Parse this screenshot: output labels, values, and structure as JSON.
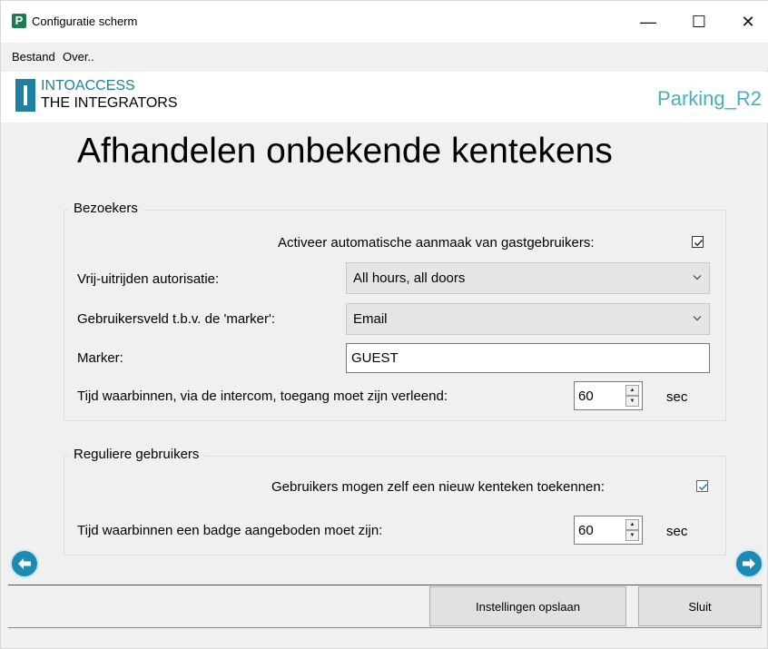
{
  "window": {
    "title": "Configuratie scherm",
    "app_icon_letter": "P",
    "controls": {
      "minimize": "—",
      "maximize": "☐",
      "close": "✕"
    }
  },
  "menu": {
    "items": [
      "Bestand",
      "Over.."
    ]
  },
  "banner": {
    "logo_line1": "INTOACCESS",
    "logo_line2": "THE INTEGRATORS",
    "site_name": "Parking_R2",
    "accent_color": "#1f7fa0"
  },
  "page_title": "Afhandelen onbekende kentekens",
  "visitors": {
    "group_label": "Bezoekers",
    "auto_guest_label": "Activeer automatische aanmaak van gastgebruikers:",
    "auto_guest_checked": true,
    "exit_auth_label": "Vrij-uitrijden autorisatie:",
    "exit_auth_value": "All hours, all doors",
    "marker_field_label": "Gebruikersveld t.b.v. de 'marker':",
    "marker_field_value": "Email",
    "marker_label": "Marker:",
    "marker_value": "GUEST",
    "intercom_time_label": "Tijd waarbinnen, via de intercom, toegang moet zijn verleend:",
    "intercom_time_value": "60",
    "intercom_time_unit": "sec"
  },
  "regular": {
    "group_label": "Reguliere gebruikers",
    "assign_plate_label": "Gebruikers mogen zelf een nieuw kenteken toekennen:",
    "assign_plate_checked": true,
    "badge_time_label": "Tijd waarbinnen een badge aangeboden moet zijn:",
    "badge_time_value": "60",
    "badge_time_unit": "sec"
  },
  "footer": {
    "save_label": "Instellingen opslaan",
    "close_label": "Sluit"
  },
  "nav": {
    "back_icon": "arrow-left-icon",
    "forward_icon": "arrow-right-icon"
  }
}
